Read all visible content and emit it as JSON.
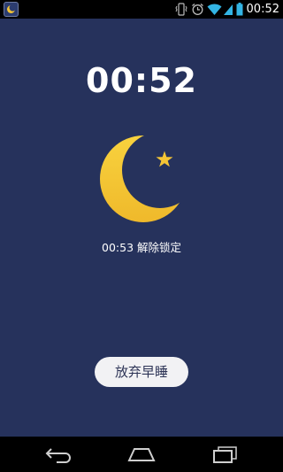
{
  "status_bar": {
    "app_icon": "moon-app-icon",
    "icons": [
      "vibrate-icon",
      "alarm-icon",
      "wifi-icon",
      "signal-icon",
      "battery-icon"
    ],
    "time": "00:52"
  },
  "clock": {
    "time": "00:52"
  },
  "moon": {
    "icon": "crescent-moon-with-star",
    "moon_color": "#f5c535",
    "star_color": "#f5c535"
  },
  "unlock": {
    "text": "00:53 解除锁定"
  },
  "actions": {
    "give_up_label": "放弃早睡"
  },
  "nav_bar": {
    "buttons": [
      "back-icon",
      "home-icon",
      "recent-apps-icon"
    ]
  },
  "colors": {
    "background": "#26325c",
    "accent": "#f5c535",
    "button_bg": "#f2f2f4"
  }
}
